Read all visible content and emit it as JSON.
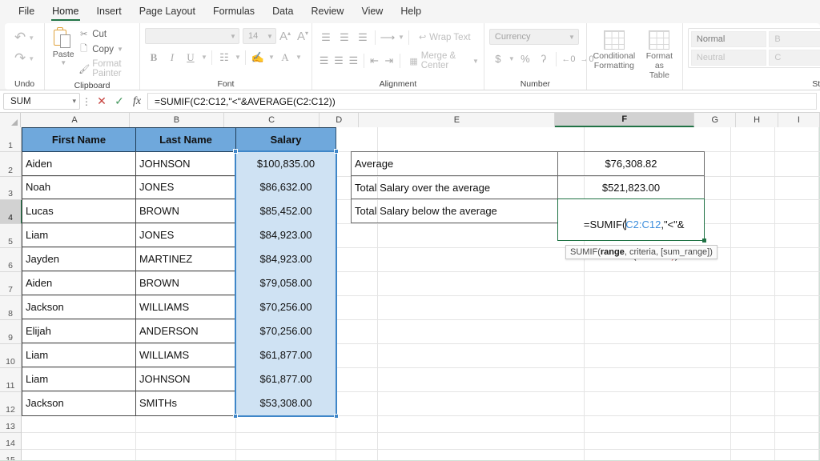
{
  "menu": {
    "items": [
      {
        "label": "File",
        "active": false
      },
      {
        "label": "Home",
        "active": true
      },
      {
        "label": "Insert",
        "active": false
      },
      {
        "label": "Page Layout",
        "active": false
      },
      {
        "label": "Formulas",
        "active": false
      },
      {
        "label": "Data",
        "active": false
      },
      {
        "label": "Review",
        "active": false
      },
      {
        "label": "View",
        "active": false
      },
      {
        "label": "Help",
        "active": false
      }
    ]
  },
  "ribbon": {
    "undo": {
      "group_label": "Undo",
      "undo_icon": "undo-arrow-icon",
      "redo_icon": "redo-arrow-icon"
    },
    "clipboard": {
      "group_label": "Clipboard",
      "paste_label": "Paste",
      "cut_label": "Cut",
      "copy_label": "Copy",
      "format_painter_label": "Format Painter"
    },
    "font": {
      "group_label": "Font",
      "font_name": "",
      "font_name_placeholder": "",
      "font_size": "14",
      "bold": "B",
      "italic": "I",
      "underline": "U"
    },
    "alignment": {
      "group_label": "Alignment",
      "wrap_text_label": "Wrap Text",
      "merge_center_label": "Merge & Center"
    },
    "number": {
      "group_label": "Number",
      "format": "Currency",
      "currency_symbol": "$",
      "percent_symbol": "%",
      "comma_symbol": "ʔ"
    },
    "styles": {
      "group_label": "Styles",
      "conditional_formatting_label": "Conditional Formatting",
      "format_as_table_label": "Format as Table",
      "cell_styles": [
        "Normal",
        "Neutral",
        "B",
        "C"
      ]
    }
  },
  "formula_bar": {
    "name_box": "SUM",
    "cancel_icon": "cancel-x-icon",
    "enter_icon": "enter-check-icon",
    "function_icon": "fx-icon",
    "formula": "=SUMIF(C2:C12,\"<\"&AVERAGE(C2:C12))"
  },
  "grid": {
    "columns": [
      "A",
      "B",
      "C",
      "D",
      "E",
      "F",
      "G",
      "H",
      "I"
    ],
    "active_column": "F",
    "rows": [
      "1",
      "2",
      "3",
      "4",
      "5",
      "6",
      "7",
      "8",
      "9",
      "10",
      "11",
      "12",
      "13",
      "14",
      "15"
    ],
    "active_row": "4",
    "headers": {
      "a": "First Name",
      "b": "Last Name",
      "c": "Salary"
    },
    "table": [
      {
        "first": "Aiden",
        "last": "JOHNSON",
        "salary": "$100,835.00"
      },
      {
        "first": "Noah",
        "last": "JONES",
        "salary": "$86,632.00"
      },
      {
        "first": "Lucas",
        "last": "BROWN",
        "salary": "$85,452.00"
      },
      {
        "first": "Liam",
        "last": "JONES",
        "salary": "$84,923.00"
      },
      {
        "first": "Jayden",
        "last": "MARTINEZ",
        "salary": "$84,923.00"
      },
      {
        "first": "Aiden",
        "last": "BROWN",
        "salary": "$79,058.00"
      },
      {
        "first": "Jackson",
        "last": "WILLIAMS",
        "salary": "$70,256.00"
      },
      {
        "first": "Elijah",
        "last": "ANDERSON",
        "salary": "$70,256.00"
      },
      {
        "first": "Liam",
        "last": "WILLIAMS",
        "salary": "$61,877.00"
      },
      {
        "first": "Liam",
        "last": "JOHNSON",
        "salary": "$61,877.00"
      },
      {
        "first": "Jackson",
        "last": "SMITHs",
        "salary": "$53,308.00"
      }
    ],
    "summary": [
      {
        "label": "Average",
        "value": "$76,308.82"
      },
      {
        "label": "Total Salary over the average",
        "value": "$521,823.00"
      },
      {
        "label": "Total Salary below the average",
        "value": ""
      }
    ],
    "edit_cell": {
      "line1_prefix": "=SUMIF(",
      "line1_ref": "C2:C12",
      "line1_suffix": ",\"<\"&",
      "line2_prefix": "AVERAGE(",
      "line2_ref": "C2:C12",
      "line2_close_red": ")",
      "line2_close_dark": ")"
    },
    "tooltip": {
      "fn": "SUMIF(",
      "arg1": "range",
      "rest": ", criteria, [sum_range])"
    }
  },
  "colors": {
    "accent_green": "#217346",
    "header_blue": "#6fa8dc",
    "salary_fill": "#cfe2f3",
    "selection_blue": "#3f86c8",
    "ref_blue": "#3c8ddc",
    "ref_red": "#c0504d"
  }
}
